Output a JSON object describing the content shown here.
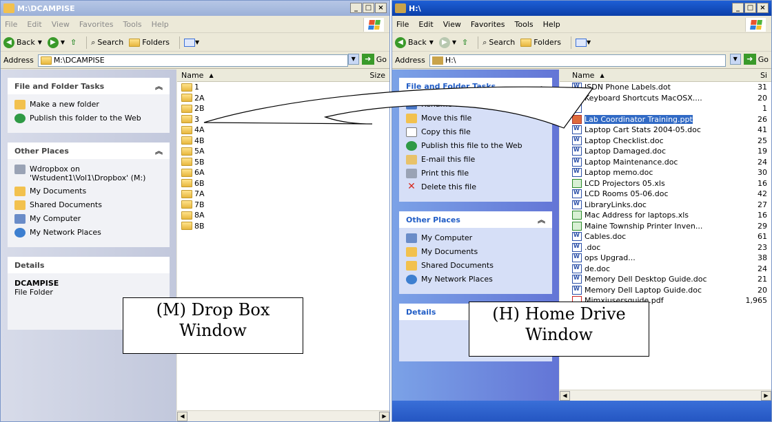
{
  "windowM": {
    "title": "M:\\DCAMPISE",
    "menu": [
      "File",
      "Edit",
      "View",
      "Favorites",
      "Tools",
      "Help"
    ],
    "toolbar": {
      "back": "Back",
      "search": "Search",
      "folders": "Folders"
    },
    "address_label": "Address",
    "address_value": "M:\\DCAMPISE",
    "go": "Go",
    "tasks_title": "File and Folder Tasks",
    "tasks": [
      "Make a new folder",
      "Publish this folder to the Web"
    ],
    "other_title": "Other Places",
    "other": [
      "Wdropbox on 'Wstudent1\\Vol1\\Dropbox' (M:)",
      "My Documents",
      "Shared Documents",
      "My Computer",
      "My Network Places"
    ],
    "details_title": "Details",
    "details_name": "DCAMPISE",
    "details_type": "File Folder",
    "col_name": "Name",
    "col_size": "Size",
    "items": [
      "1",
      "2A",
      "2B",
      "3",
      "4A",
      "4B",
      "5A",
      "5B",
      "6A",
      "6B",
      "7A",
      "7B",
      "8A",
      "8B"
    ]
  },
  "windowH": {
    "title": "H:\\",
    "menu": [
      "File",
      "Edit",
      "View",
      "Favorites",
      "Tools",
      "Help"
    ],
    "toolbar": {
      "back": "Back",
      "search": "Search",
      "folders": "Folders"
    },
    "address_label": "Address",
    "address_value": "H:\\",
    "go": "Go",
    "tasks_title": "File and Folder Tasks",
    "tasks": [
      "Rename this file",
      "Move this file",
      "Copy this file",
      "Publish this file to the Web",
      "E-mail this file",
      "Print this file",
      "Delete this file"
    ],
    "other_title": "Other Places",
    "other": [
      "My Computer",
      "My Documents",
      "Shared Documents",
      "My Network Places"
    ],
    "details_title": "Details",
    "col_name": "Name",
    "col_size": "Si",
    "files": [
      {
        "name": "ISDN Phone Labels.dot",
        "size": "31",
        "kind": "doc"
      },
      {
        "name": "Keyboard Shortcuts MacOSX....",
        "size": "20",
        "kind": "doc"
      },
      {
        "name": "",
        "size": "1",
        "kind": "doc"
      },
      {
        "name": "Lab Coordinator Training.ppt",
        "size": "26",
        "kind": "ppt",
        "selected": true
      },
      {
        "name": "Laptop Cart Stats 2004-05.doc",
        "size": "41",
        "kind": "doc"
      },
      {
        "name": "Laptop Checklist.doc",
        "size": "25",
        "kind": "doc"
      },
      {
        "name": "Laptop Damaged.doc",
        "size": "19",
        "kind": "doc"
      },
      {
        "name": "Laptop Maintenance.doc",
        "size": "24",
        "kind": "doc"
      },
      {
        "name": "Laptop memo.doc",
        "size": "30",
        "kind": "doc"
      },
      {
        "name": "LCD Projectors 05.xls",
        "size": "16",
        "kind": "xls"
      },
      {
        "name": "LCD Rooms 05-06.doc",
        "size": "42",
        "kind": "doc"
      },
      {
        "name": "LibraryLinks.doc",
        "size": "27",
        "kind": "doc"
      },
      {
        "name": "Mac Address for laptops.xls",
        "size": "16",
        "kind": "xls"
      },
      {
        "name": "Maine Township Printer Inven...",
        "size": "29",
        "kind": "xls"
      },
      {
        "name": "Cables.doc",
        "size": "61",
        "kind": "doc"
      },
      {
        "name": ".doc",
        "size": "23",
        "kind": "doc"
      },
      {
        "name": "ops Upgrad...",
        "size": "38",
        "kind": "doc"
      },
      {
        "name": "de.doc",
        "size": "24",
        "kind": "doc"
      },
      {
        "name": "Memory Dell Desktop Guide.doc",
        "size": "21",
        "kind": "doc"
      },
      {
        "name": "Memory Dell Laptop Guide.doc",
        "size": "20",
        "kind": "doc"
      },
      {
        "name": "Mimxiusersguide.pdf",
        "size": "1,965",
        "kind": "pdf"
      }
    ]
  },
  "callouts": {
    "m_line1": "(M) Drop Box",
    "m_line2": "Window",
    "h_line1": "(H) Home Drive",
    "h_line2": "Window"
  },
  "colors": {
    "xp_blue": "#0b3fa8",
    "selection": "#316ac5",
    "task_blue": "#6375d6"
  }
}
